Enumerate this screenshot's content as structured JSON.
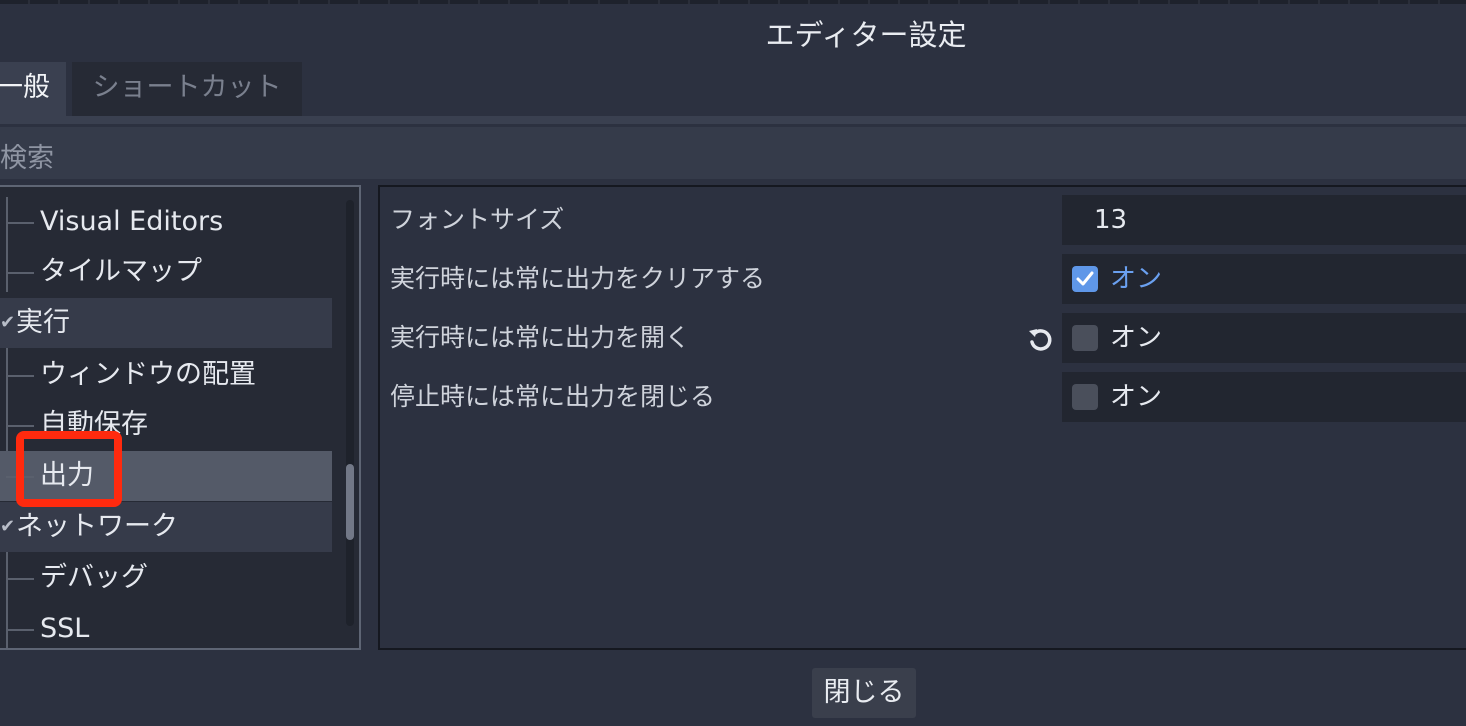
{
  "window": {
    "title": "エディター設定"
  },
  "tabs": [
    {
      "label": "一般"
    },
    {
      "label": "ショートカット"
    }
  ],
  "search": {
    "placeholder": "検索"
  },
  "tree": {
    "items": [
      {
        "label": "Visual Editors",
        "type": "child"
      },
      {
        "label": "タイルマップ",
        "type": "child"
      },
      {
        "label": "実行",
        "type": "category"
      },
      {
        "label": "ウィンドウの配置",
        "type": "child"
      },
      {
        "label": "自動保存",
        "type": "child"
      },
      {
        "label": "出力",
        "type": "child",
        "selected": true
      },
      {
        "label": "ネットワーク",
        "type": "category"
      },
      {
        "label": "デバッグ",
        "type": "child"
      },
      {
        "label": "SSL",
        "type": "child"
      }
    ]
  },
  "properties": [
    {
      "name": "フォントサイズ",
      "value": "13"
    },
    {
      "name": "実行時には常に出力をクリアする",
      "checked": true,
      "value_label": "オン"
    },
    {
      "name": "実行時には常に出力を開く",
      "checked": false,
      "value_label": "オン",
      "revert_icon": "revert-icon"
    },
    {
      "name": "停止時には常に出力を閉じる",
      "checked": false,
      "value_label": "オン"
    }
  ],
  "footer": {
    "close_label": "閉じる"
  },
  "colors": {
    "accent": "#5f97e8",
    "highlight_box": "#ff2a0e"
  }
}
